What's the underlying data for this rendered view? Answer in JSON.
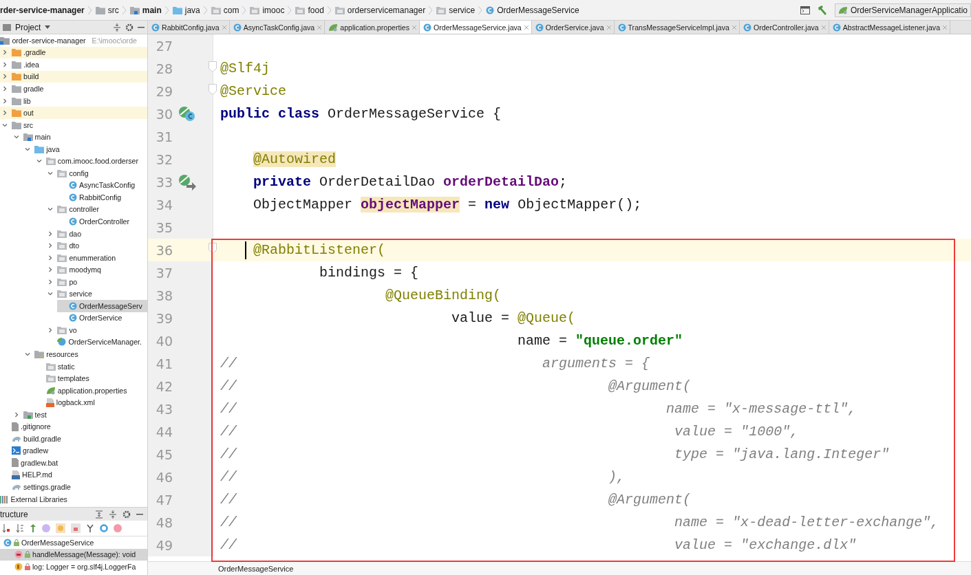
{
  "breadcrumbs": [
    {
      "label": "rder-service-manager",
      "kind": "module"
    },
    {
      "label": "src",
      "kind": "folder"
    },
    {
      "label": "main",
      "kind": "source-folder"
    },
    {
      "label": "java",
      "kind": "java-folder"
    },
    {
      "label": "com",
      "kind": "package"
    },
    {
      "label": "imooc",
      "kind": "package"
    },
    {
      "label": "food",
      "kind": "package"
    },
    {
      "label": "orderservicemanager",
      "kind": "package"
    },
    {
      "label": "service",
      "kind": "package"
    },
    {
      "label": "OrderMessageService",
      "kind": "class"
    }
  ],
  "run_config": {
    "label": "OrderServiceManagerApplicatio"
  },
  "project_panel": {
    "title": "Project",
    "tree": [
      {
        "label": "order-service-manager",
        "kind": "module",
        "path": "E:\\imooc\\orde",
        "children": [
          {
            "label": ".gradle",
            "kind": "folder",
            "expanded": false,
            "excluded": true
          },
          {
            "label": ".idea",
            "kind": "folder",
            "expanded": false,
            "excluded": false
          },
          {
            "label": "build",
            "kind": "folder",
            "expanded": false,
            "excluded": true
          },
          {
            "label": "gradle",
            "kind": "folder",
            "expanded": false,
            "excluded": false
          },
          {
            "label": "lib",
            "kind": "folder",
            "expanded": false,
            "excluded": false
          },
          {
            "label": "out",
            "kind": "folder",
            "expanded": false,
            "excluded": true
          },
          {
            "label": "src",
            "kind": "folder",
            "expanded": true,
            "excluded": false,
            "children": [
              {
                "label": "main",
                "kind": "source-folder",
                "expanded": true,
                "children": [
                  {
                    "label": "java",
                    "kind": "java-folder",
                    "expanded": true,
                    "children": [
                      {
                        "label": "com.imooc.food.orderser",
                        "kind": "package",
                        "expanded": true,
                        "children": [
                          {
                            "label": "config",
                            "kind": "package",
                            "expanded": true,
                            "children": [
                              {
                                "label": "AsyncTaskConfig",
                                "kind": "class",
                                "selected": false
                              },
                              {
                                "label": "RabbitConfig",
                                "kind": "class",
                                "selected": false
                              }
                            ]
                          },
                          {
                            "label": "controller",
                            "kind": "package",
                            "expanded": true,
                            "children": [
                              {
                                "label": "OrderController",
                                "kind": "class",
                                "selected": false
                              }
                            ]
                          },
                          {
                            "label": "dao",
                            "kind": "package",
                            "expanded": false
                          },
                          {
                            "label": "dto",
                            "kind": "package",
                            "expanded": false
                          },
                          {
                            "label": "enummeration",
                            "kind": "package",
                            "expanded": false
                          },
                          {
                            "label": "moodymq",
                            "kind": "package",
                            "expanded": false
                          },
                          {
                            "label": "po",
                            "kind": "package",
                            "expanded": false
                          },
                          {
                            "label": "service",
                            "kind": "package",
                            "expanded": true,
                            "children": [
                              {
                                "label": "OrderMessageServ",
                                "kind": "class",
                                "selected": true
                              },
                              {
                                "label": "OrderService",
                                "kind": "class",
                                "selected": false
                              }
                            ]
                          },
                          {
                            "label": "vo",
                            "kind": "package",
                            "expanded": false
                          },
                          {
                            "label": "OrderServiceManager.",
                            "kind": "spring-class",
                            "selected": false
                          }
                        ]
                      }
                    ]
                  },
                  {
                    "label": "resources",
                    "kind": "resources-folder",
                    "expanded": true,
                    "children": [
                      {
                        "label": "static",
                        "kind": "package"
                      },
                      {
                        "label": "templates",
                        "kind": "package"
                      },
                      {
                        "label": "application.properties",
                        "kind": "properties",
                        "selected": false
                      },
                      {
                        "label": "logback.xml",
                        "kind": "xml",
                        "selected": false
                      }
                    ]
                  }
                ]
              },
              {
                "label": "test",
                "kind": "test-folder",
                "expanded": false
              }
            ]
          },
          {
            "label": ".gitignore",
            "kind": "file"
          },
          {
            "label": "build.gradle",
            "kind": "gradle"
          },
          {
            "label": "gradlew",
            "kind": "script"
          },
          {
            "label": "gradlew.bat",
            "kind": "file"
          },
          {
            "label": "HELP.md",
            "kind": "markdown"
          },
          {
            "label": "settings.gradle",
            "kind": "gradle"
          }
        ]
      },
      {
        "label": "External Libraries",
        "kind": "libraries"
      }
    ]
  },
  "structure_panel": {
    "title": "tructure",
    "items": [
      {
        "label": "OrderMessageService",
        "kind": "class",
        "selected": false,
        "children": [
          {
            "label": "handleMessage(Message): void",
            "kind": "method",
            "selected": true
          },
          {
            "label": "log: Logger = org.slf4j.LoggerFa",
            "kind": "field",
            "selected": false
          }
        ]
      }
    ]
  },
  "tabs": [
    {
      "label": "RabbitConfig.java",
      "kind": "class",
      "selected": false
    },
    {
      "label": "AsyncTaskConfig.java",
      "kind": "class",
      "selected": false
    },
    {
      "label": "application.properties",
      "kind": "properties",
      "selected": false
    },
    {
      "label": "OrderMessageService.java",
      "kind": "class",
      "selected": true
    },
    {
      "label": "OrderService.java",
      "kind": "class",
      "selected": false
    },
    {
      "label": "TransMessageServiceImpl.java",
      "kind": "class",
      "selected": false
    },
    {
      "label": "OrderController.java",
      "kind": "class",
      "selected": false
    },
    {
      "label": "AbstractMessageListener.java",
      "kind": "class",
      "selected": false
    }
  ],
  "code": {
    "lines": [
      {
        "number": "27",
        "current": false
      },
      {
        "number": "28",
        "current": false,
        "fold": true,
        "tokens": [
          {
            "text": "@Slf4j",
            "kind": "annotation"
          }
        ]
      },
      {
        "number": "29",
        "current": false,
        "fold": true,
        "tokens": [
          {
            "text": "@Service",
            "kind": "annotation"
          }
        ]
      },
      {
        "number": "30",
        "current": false,
        "kind": "class-marker",
        "tokens": [
          {
            "text": "public class",
            "kind": "keyword"
          },
          {
            "text": " OrderMessageService {",
            "kind": "plain"
          }
        ]
      },
      {
        "number": "31",
        "current": false
      },
      {
        "number": "32",
        "current": false,
        "tokens": [
          {
            "text": "    @Autowired",
            "kind": "annotation",
            "marked": true
          }
        ]
      },
      {
        "number": "33",
        "current": false,
        "kind": "bean-marker",
        "tokens": [
          {
            "text": "    private",
            "kind": "keyword"
          },
          {
            "text": " OrderDetailDao ",
            "kind": "plain"
          },
          {
            "text": "orderDetailDao",
            "kind": "field"
          },
          {
            "text": ";",
            "kind": "plain"
          }
        ]
      },
      {
        "number": "34",
        "current": false,
        "tokens": [
          {
            "text": "    ObjectMapper ",
            "kind": "plain"
          },
          {
            "text": "objectMapper",
            "kind": "field",
            "marked": true
          },
          {
            "text": " = ",
            "kind": "plain"
          },
          {
            "text": "new",
            "kind": "keyword"
          },
          {
            "text": " ObjectMapper();",
            "kind": "plain"
          }
        ]
      },
      {
        "number": "35",
        "current": false
      },
      {
        "number": "36",
        "current": true,
        "fold": true,
        "tokens": [
          {
            "text": "    @RabbitListener(",
            "kind": "annotation"
          }
        ]
      },
      {
        "number": "37",
        "current": false,
        "tokens": [
          {
            "text": "            bindings = {",
            "kind": "plain"
          }
        ]
      },
      {
        "number": "38",
        "current": false,
        "tokens": [
          {
            "text": "                    @QueueBinding(",
            "kind": "annotation"
          }
        ]
      },
      {
        "number": "39",
        "current": false,
        "tokens": [
          {
            "text": "                            value = ",
            "kind": "plain"
          },
          {
            "text": "@Queue(",
            "kind": "annotation"
          }
        ]
      },
      {
        "number": "40",
        "current": false,
        "tokens": [
          {
            "text": "                                    name = ",
            "kind": "plain"
          },
          {
            "text": "\"queue.order\"",
            "kind": "string"
          }
        ]
      },
      {
        "number": "41",
        "current": false,
        "tokens": [
          {
            "text": "//                                     arguments = {",
            "kind": "comment"
          }
        ]
      },
      {
        "number": "42",
        "current": false,
        "tokens": [
          {
            "text": "//                                             @Argument(",
            "kind": "comment"
          }
        ]
      },
      {
        "number": "43",
        "current": false,
        "tokens": [
          {
            "text": "//                                                    name = \"x-message-ttl\",",
            "kind": "comment"
          }
        ]
      },
      {
        "number": "44",
        "current": false,
        "tokens": [
          {
            "text": "//                                                     value = \"1000\",",
            "kind": "comment"
          }
        ]
      },
      {
        "number": "45",
        "current": false,
        "tokens": [
          {
            "text": "//                                                     type = \"java.lang.Integer\"",
            "kind": "comment"
          }
        ]
      },
      {
        "number": "46",
        "current": false,
        "tokens": [
          {
            "text": "//                                             ),",
            "kind": "comment"
          }
        ]
      },
      {
        "number": "47",
        "current": false,
        "tokens": [
          {
            "text": "//                                             @Argument(",
            "kind": "comment"
          }
        ]
      },
      {
        "number": "48",
        "current": false,
        "tokens": [
          {
            "text": "//                                                     name = \"x-dead-letter-exchange\",",
            "kind": "comment"
          }
        ]
      },
      {
        "number": "49",
        "current": false,
        "tokens": [
          {
            "text": "//                                                     value = \"exchange.dlx\"",
            "kind": "comment"
          }
        ]
      }
    ]
  },
  "editor_breadcrumb": "OrderMessageService"
}
